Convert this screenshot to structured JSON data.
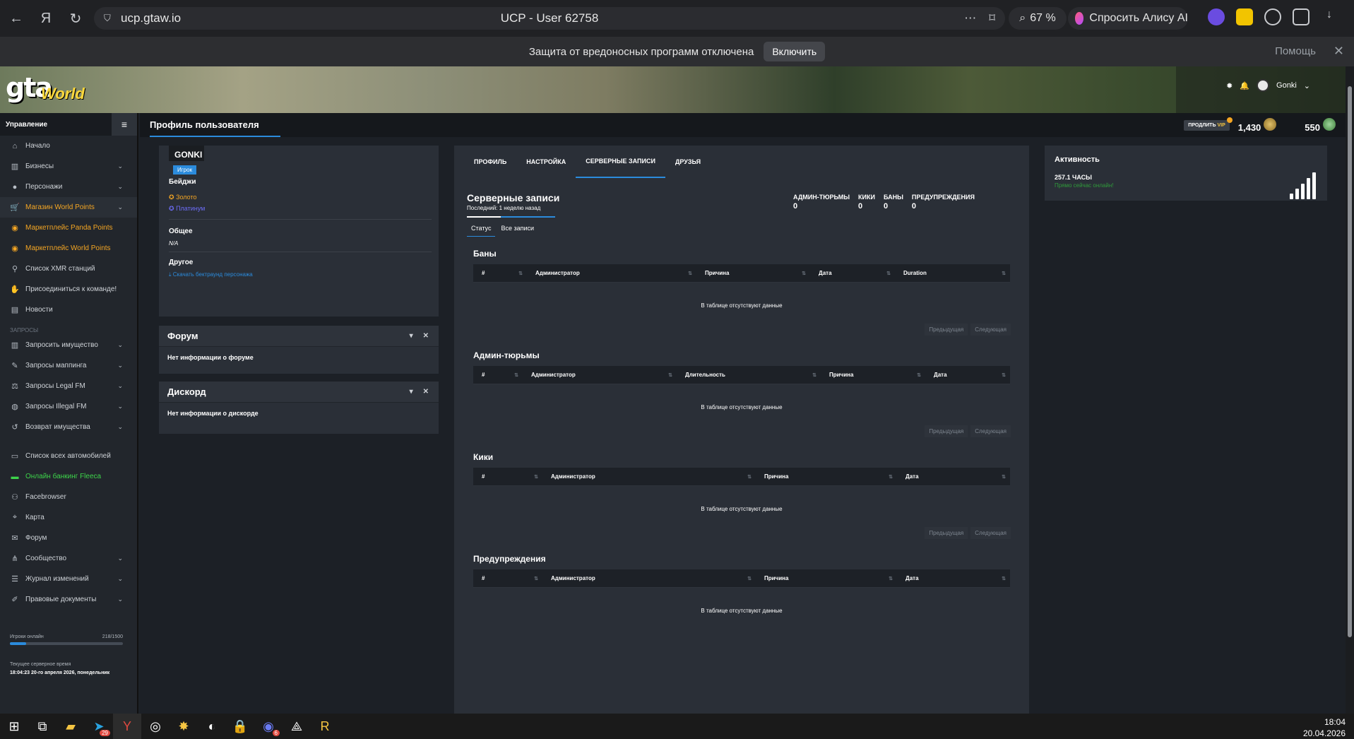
{
  "browser": {
    "url": "ucp.gtaw.io",
    "tab_title": "UCP - User 62758",
    "zoom": "67 %",
    "alice": "Спросить Алису AI",
    "notice": "Защита от вредоносных программ отключена",
    "notice_button": "Включить",
    "notice_help": "Помощь"
  },
  "site": {
    "logo_main": "gta",
    "logo_sub": "World",
    "user": "Gonki"
  },
  "sidebar": {
    "header": "Управление",
    "items": [
      {
        "label": "Начало",
        "icon": "home-icon"
      },
      {
        "label": "Бизнесы",
        "icon": "building-icon"
      },
      {
        "label": "Персонажи",
        "icon": "user-icon"
      },
      {
        "label": "Магазин World Points",
        "icon": "cart-icon"
      },
      {
        "label": "Маркетплейс Panda Points",
        "icon": "coins-icon"
      },
      {
        "label": "Маркетплейс World Points",
        "icon": "coins-icon"
      },
      {
        "label": "Список XMR станций",
        "icon": "antenna-icon"
      },
      {
        "label": "Присоединиться к команде!",
        "icon": "handshake-icon"
      },
      {
        "label": "Новости",
        "icon": "news-icon"
      }
    ],
    "section_requests": "ЗАПРОСЫ",
    "request_items": [
      {
        "label": "Запросить имущество",
        "icon": "building-icon"
      },
      {
        "label": "Запросы маппинга",
        "icon": "brush-icon"
      },
      {
        "label": "Запросы Legal FM",
        "icon": "scale-icon"
      },
      {
        "label": "Запросы Illegal FM",
        "icon": "mask-icon"
      },
      {
        "label": "Возврат имущества",
        "icon": "undo-icon"
      }
    ],
    "other_items": [
      {
        "label": "Список всех автомобилей",
        "icon": "car-icon"
      },
      {
        "label": "Онлайн банкинг Fleeca",
        "icon": "bank-icon"
      },
      {
        "label": "Facebrowser",
        "icon": "users-icon"
      },
      {
        "label": "Карта",
        "icon": "map-icon"
      },
      {
        "label": "Форум",
        "icon": "comments-icon"
      },
      {
        "label": "Сообщество",
        "icon": "share-icon"
      },
      {
        "label": "Журнал изменений",
        "icon": "list-icon"
      },
      {
        "label": "Правовые документы",
        "icon": "document-icon"
      }
    ],
    "online_label": "Игроки онлайн",
    "online_count": "218/1500",
    "online_fraction": 0.145,
    "time_label": "Текущее серверное время",
    "time_value": "18:04:23 20-го апреля 2026, понедельник"
  },
  "topbar": {
    "title": "Профиль пользователя",
    "vip_prefix": "ПРОДЛИТЬ",
    "vip_suffix": "VIP",
    "world_points": "1,430",
    "panda_points": "550"
  },
  "profile": {
    "name": "GONKI",
    "role": "Игрок",
    "badges_label": "Бейджи",
    "badge_gold": "Золото",
    "badge_platinum": "Платинум",
    "general_label": "Общее",
    "general_value": "N/A",
    "other_label": "Другое",
    "other_link": "Скачать бектраунд персонажа"
  },
  "forum": {
    "title": "Форум",
    "body": "Нет информации о форуме"
  },
  "discord": {
    "title": "Дискорд",
    "body": "Нет информации о дискорде"
  },
  "tabs": [
    "ПРОФИЛЬ",
    "НАСТРОЙКА",
    "СЕРВЕРНЫЕ ЗАПИСИ",
    "ДРУЗЬЯ"
  ],
  "records": {
    "title": "Серверные записи",
    "subtitle": "Последний: 1 неделю назад",
    "stats": [
      {
        "label": "АДМИН-ТЮРЬМЫ",
        "value": "0"
      },
      {
        "label": "КИКИ",
        "value": "0"
      },
      {
        "label": "БАНЫ",
        "value": "0"
      },
      {
        "label": "ПРЕДУПРЕЖДЕНИЯ",
        "value": "0"
      }
    ],
    "subtab_status": "Статус",
    "subtab_all": "Все записи",
    "empty": "В таблице отсутствуют данные",
    "prev": "Предыдущая",
    "next": "Следующая",
    "bans": {
      "title": "Баны",
      "cols": [
        "#",
        "Администратор",
        "Причина",
        "Дата",
        "Duration"
      ]
    },
    "jails": {
      "title": "Админ-тюрьмы",
      "cols": [
        "#",
        "Администратор",
        "Длительность",
        "Причина",
        "Дата"
      ]
    },
    "kicks": {
      "title": "Кики",
      "cols": [
        "#",
        "Администратор",
        "Причина",
        "Дата"
      ]
    },
    "warns": {
      "title": "Предупреждения",
      "cols": [
        "#",
        "Администратор",
        "Причина",
        "Дата"
      ]
    }
  },
  "activity": {
    "title": "Активность",
    "hours": "257.1 ЧАСЫ",
    "status": "Прямо сейчас онлайн!"
  },
  "taskbar": {
    "time": "18:04",
    "date": "20.04.2026",
    "telegram_badge": "29",
    "discord_badge": "6"
  }
}
